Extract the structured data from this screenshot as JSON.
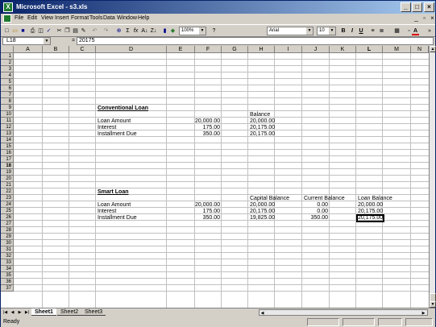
{
  "app": {
    "title": "Microsoft Excel - s3.xls"
  },
  "title_buttons": {
    "minimize": "_",
    "maximize": "□",
    "close": "×"
  },
  "menu": [
    "File",
    "Edit",
    "View",
    "Insert",
    "Format",
    "Tools",
    "Data",
    "Window",
    "Help"
  ],
  "doc_controls": {
    "minimize": "_",
    "restore": "▫",
    "close": "×"
  },
  "toolbar": {
    "zoom": "100%",
    "font_name": "Arial",
    "font_size": "10",
    "bold": "B",
    "italic": "I",
    "underline": "U"
  },
  "formula_bar": {
    "name_box": "L18",
    "fx": "=",
    "formula": "20175"
  },
  "columns": [
    "A",
    "B",
    "C",
    "D",
    "E",
    "F",
    "G",
    "H",
    "I",
    "J",
    "K",
    "L",
    "M",
    "N"
  ],
  "rows": [
    "1",
    "2",
    "3",
    "4",
    "5",
    "6",
    "7",
    "8",
    "9",
    "10",
    "11",
    "12",
    "13",
    "14",
    "15",
    "16",
    "17",
    "18",
    "19",
    "20",
    "21",
    "22",
    "23",
    "24",
    "25",
    "26",
    "27",
    "28",
    "29",
    "30",
    "31",
    "32",
    "33",
    "34",
    "35",
    "36",
    "37"
  ],
  "cells": {
    "conv_title": "Conventional Loan",
    "balance_hdr": "Balance",
    "loan_amount_1": "Loan Amount",
    "loan_amount_1_val": "20,000.00",
    "loan_amount_1_bal": "20,000.00",
    "interest_1": "Interest",
    "interest_1_val": "175.00",
    "interest_1_bal": "20,175.00",
    "inst_1": "Installment Due",
    "inst_1_val": "350.00",
    "inst_1_bal": "20,175.00",
    "smart_title": "Smart Loan",
    "cap_bal_hdr": "Capital Balance",
    "cur_bal_hdr": "Current Balance",
    "loan_bal_hdr": "Loan Balance",
    "loan_amount_2": "Loan Amount",
    "loan_amount_2_val": "20,000.00",
    "loan_amount_2_cap": "20,000.00",
    "loan_amount_2_cur": "0.00",
    "loan_amount_2_loan": "20,000.00",
    "interest_2": "Interest",
    "interest_2_val": "175.00",
    "interest_2_cap": "20,175.00",
    "interest_2_cur": "0.00",
    "interest_2_loan": "20,175.00",
    "inst_2": "Installment Due",
    "inst_2_val": "350.00",
    "inst_2_cap": "19,825.00",
    "inst_2_cur": "350.00",
    "inst_2_loan": "20,175.00"
  },
  "sheets": [
    "Sheet1",
    "Sheet2",
    "Sheet3"
  ],
  "status": "Ready"
}
